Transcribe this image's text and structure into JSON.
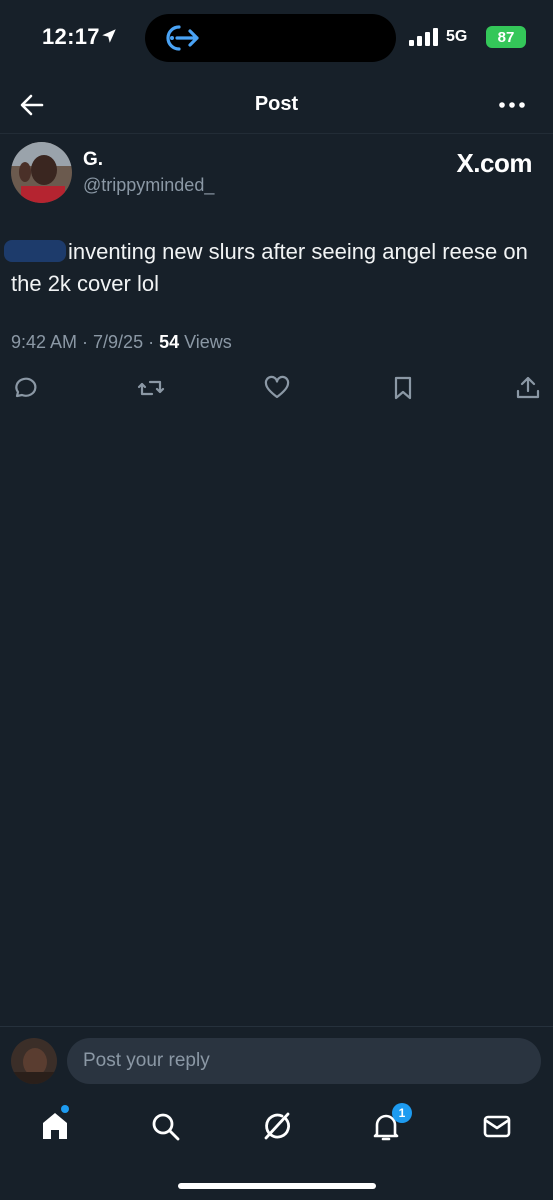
{
  "status_bar": {
    "time": "12:17",
    "network": "5G",
    "battery": "87",
    "icons": [
      "location-arrow-icon",
      "signal-bars-icon",
      "battery-icon"
    ]
  },
  "header": {
    "title": "Post",
    "icons": [
      "back-arrow-icon",
      "more-dots-icon"
    ]
  },
  "post": {
    "author_name": "G.",
    "author_handle": "@trippyminded_",
    "source_label": "X.com",
    "text": "inventing new slurs after seeing angel reese on the 2k cover lol",
    "timestamp": "9:42 AM · 7/9/25 · ",
    "views_count": "54",
    "views_label": " Views",
    "actions": [
      "reply-icon",
      "repost-icon",
      "like-icon",
      "bookmark-icon",
      "share-icon"
    ]
  },
  "reply": {
    "placeholder": "Post your reply"
  },
  "tab_bar": {
    "tabs": [
      "home-icon",
      "search-icon",
      "grok-icon",
      "notifications-icon",
      "messages-icon"
    ],
    "notification_count": "1"
  },
  "colors": {
    "background": "#172029",
    "accent": "#1d9bf0",
    "muted_text": "#8b98a5",
    "battery": "#34c759"
  }
}
